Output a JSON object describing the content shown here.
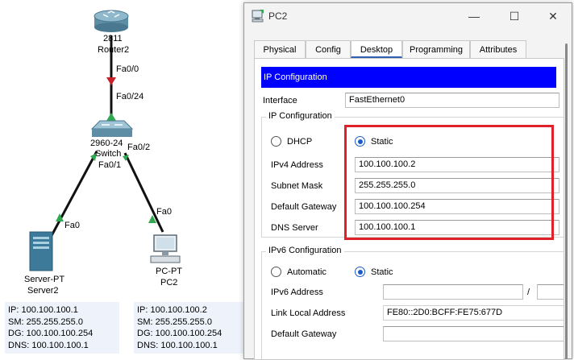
{
  "topology": {
    "router": {
      "model": "2811",
      "name": "Router2",
      "port_down": "Fa0/0"
    },
    "switch": {
      "model": "2960-24",
      "name": "Switch",
      "port_up": "Fa0/24",
      "port_left": "Fa0/1",
      "port_right": "Fa0/2"
    },
    "server": {
      "type": "Server-PT",
      "name": "Server2",
      "port": "Fa0"
    },
    "pc": {
      "type": "PC-PT",
      "name": "PC2",
      "port": "Fa0"
    },
    "server_note": [
      "IP: 100.100.100.1",
      "SM: 255.255.255.0",
      "DG: 100.100.100.254",
      "DNS: 100.100.100.1"
    ],
    "pc_note": [
      "IP: 100.100.100.2",
      "SM: 255.255.255.0",
      "DG: 100.100.100.254",
      "DNS: 100.100.100.1"
    ],
    "link_color": "#111111",
    "link_up_color": "#2fa84f",
    "link_down_color": "#c8202a"
  },
  "window": {
    "title": "PC2",
    "minimize": "—",
    "maximize": "☐",
    "close": "✕",
    "tabs": [
      "Physical",
      "Config",
      "Desktop",
      "Programming",
      "Attributes"
    ],
    "active_tab": "Desktop"
  },
  "ipconfig": {
    "header": "IP Configuration",
    "interface_label": "Interface",
    "interface_value": "FastEthernet0",
    "ipv4_group": "IP Configuration",
    "dhcp_label": "DHCP",
    "static_label": "Static",
    "ipv4_label": "IPv4 Address",
    "ipv4_value": "100.100.100.2",
    "mask_label": "Subnet Mask",
    "mask_value": "255.255.255.0",
    "gateway_label": "Default Gateway",
    "gateway_value": "100.100.100.254",
    "dns_label": "DNS Server",
    "dns_value": "100.100.100.1",
    "ipv6_group": "IPv6 Configuration",
    "auto_label": "Automatic",
    "static6_label": "Static",
    "ipv6_label": "IPv6 Address",
    "ipv6_value": "",
    "ipv6_slash": "/",
    "ipv6_prefix": "",
    "link_local_label": "Link Local Address",
    "link_local_value": "FE80::2D0:BCFF:FE75:677D",
    "gateway6_label": "Default Gateway",
    "gateway6_value": ""
  },
  "colors": {
    "header_bg": "#0000ff",
    "highlight": "#e0202a",
    "radio": "#1a5cc8"
  }
}
